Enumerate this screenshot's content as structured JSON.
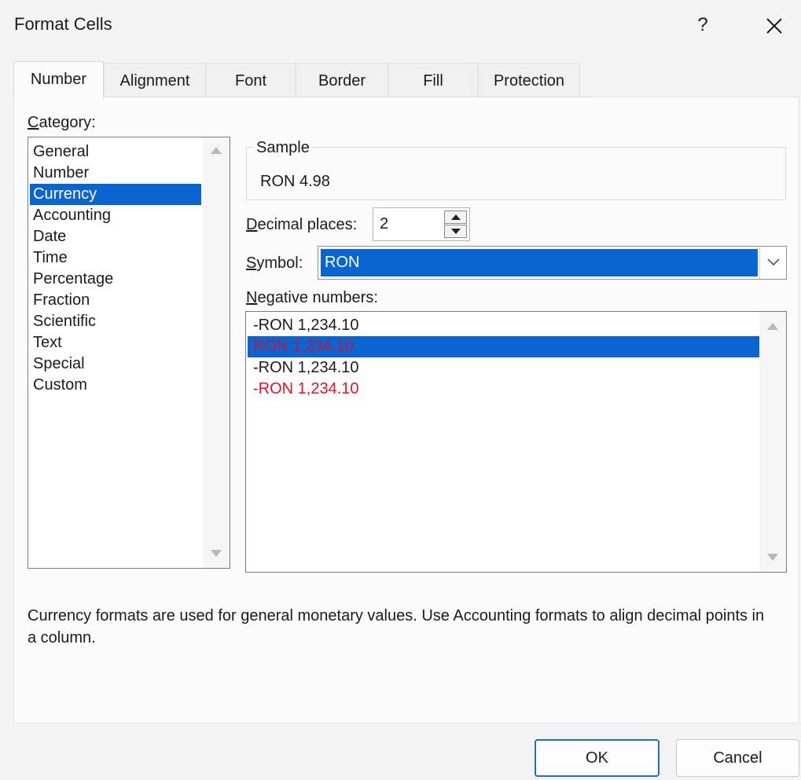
{
  "window": {
    "title": "Format Cells",
    "help_label": "?",
    "close_icon": "close-icon"
  },
  "tabs": [
    {
      "label": "Number",
      "active": true
    },
    {
      "label": "Alignment"
    },
    {
      "label": "Font"
    },
    {
      "label": "Border"
    },
    {
      "label": "Fill"
    },
    {
      "label": "Protection"
    }
  ],
  "category": {
    "label_accel": "C",
    "label_rest": "ategory:",
    "items": [
      "General",
      "Number",
      "Currency",
      "Accounting",
      "Date",
      "Time",
      "Percentage",
      "Fraction",
      "Scientific",
      "Text",
      "Special",
      "Custom"
    ],
    "selected": "Currency"
  },
  "sample": {
    "legend": "Sample",
    "value": "RON 4.98"
  },
  "decimal_places": {
    "label_accel": "D",
    "label_rest": "ecimal places:",
    "value": "2"
  },
  "symbol": {
    "label_accel": "S",
    "label_rest": "ymbol:",
    "value": "RON"
  },
  "negative_numbers": {
    "label_accel": "N",
    "label_rest": "egative numbers:",
    "items": [
      {
        "text": "-RON 1,234.10",
        "color": "#1b1b1b"
      },
      {
        "text": "RON 1,234.10",
        "color": "#c3163a",
        "selected": true
      },
      {
        "text": "-RON 1,234.10",
        "color": "#1b1b1b"
      },
      {
        "text": "-RON 1,234.10",
        "color": "#e81123"
      }
    ]
  },
  "description": "Currency formats are used for general monetary values.  Use Accounting formats to align decimal points in a column.",
  "buttons": {
    "ok": "OK",
    "cancel": "Cancel"
  },
  "colors": {
    "accent": "#0a64d2",
    "default_button_border": "#1e6fd1"
  }
}
